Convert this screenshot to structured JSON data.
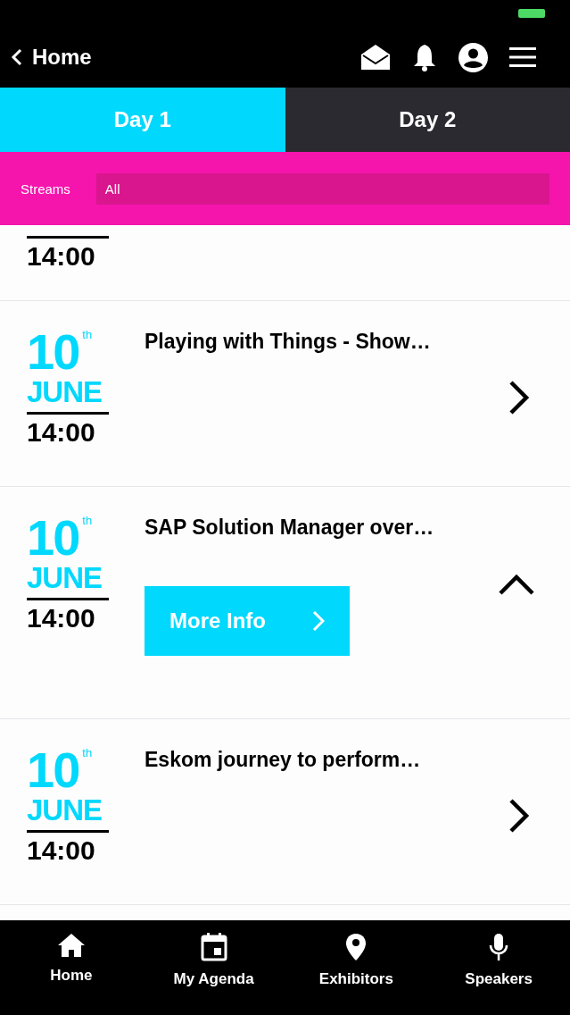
{
  "header": {
    "back_label": "Home"
  },
  "tabs": [
    {
      "label": "Day 1",
      "selected": true
    },
    {
      "label": "Day 2",
      "selected": false
    }
  ],
  "filter": {
    "label": "Streams",
    "value": "All"
  },
  "sessions": [
    {
      "kind": "partial",
      "time": "14:00"
    },
    {
      "kind": "full",
      "day": "10",
      "suffix": "th",
      "month": "JUNE",
      "time": "14:00",
      "title": "Playing with Things - Show…",
      "expanded": false
    },
    {
      "kind": "full",
      "day": "10",
      "suffix": "th",
      "month": "JUNE",
      "time": "14:00",
      "title": "SAP Solution Manager over…",
      "expanded": true,
      "button": "More Info"
    },
    {
      "kind": "full",
      "day": "10",
      "suffix": "th",
      "month": "JUNE",
      "time": "14:00",
      "title": "Eskom journey to perform…",
      "expanded": false
    }
  ],
  "bottom_nav": [
    {
      "label": "Home"
    },
    {
      "label": "My Agenda"
    },
    {
      "label": "Exhibitors"
    },
    {
      "label": "Speakers"
    }
  ]
}
